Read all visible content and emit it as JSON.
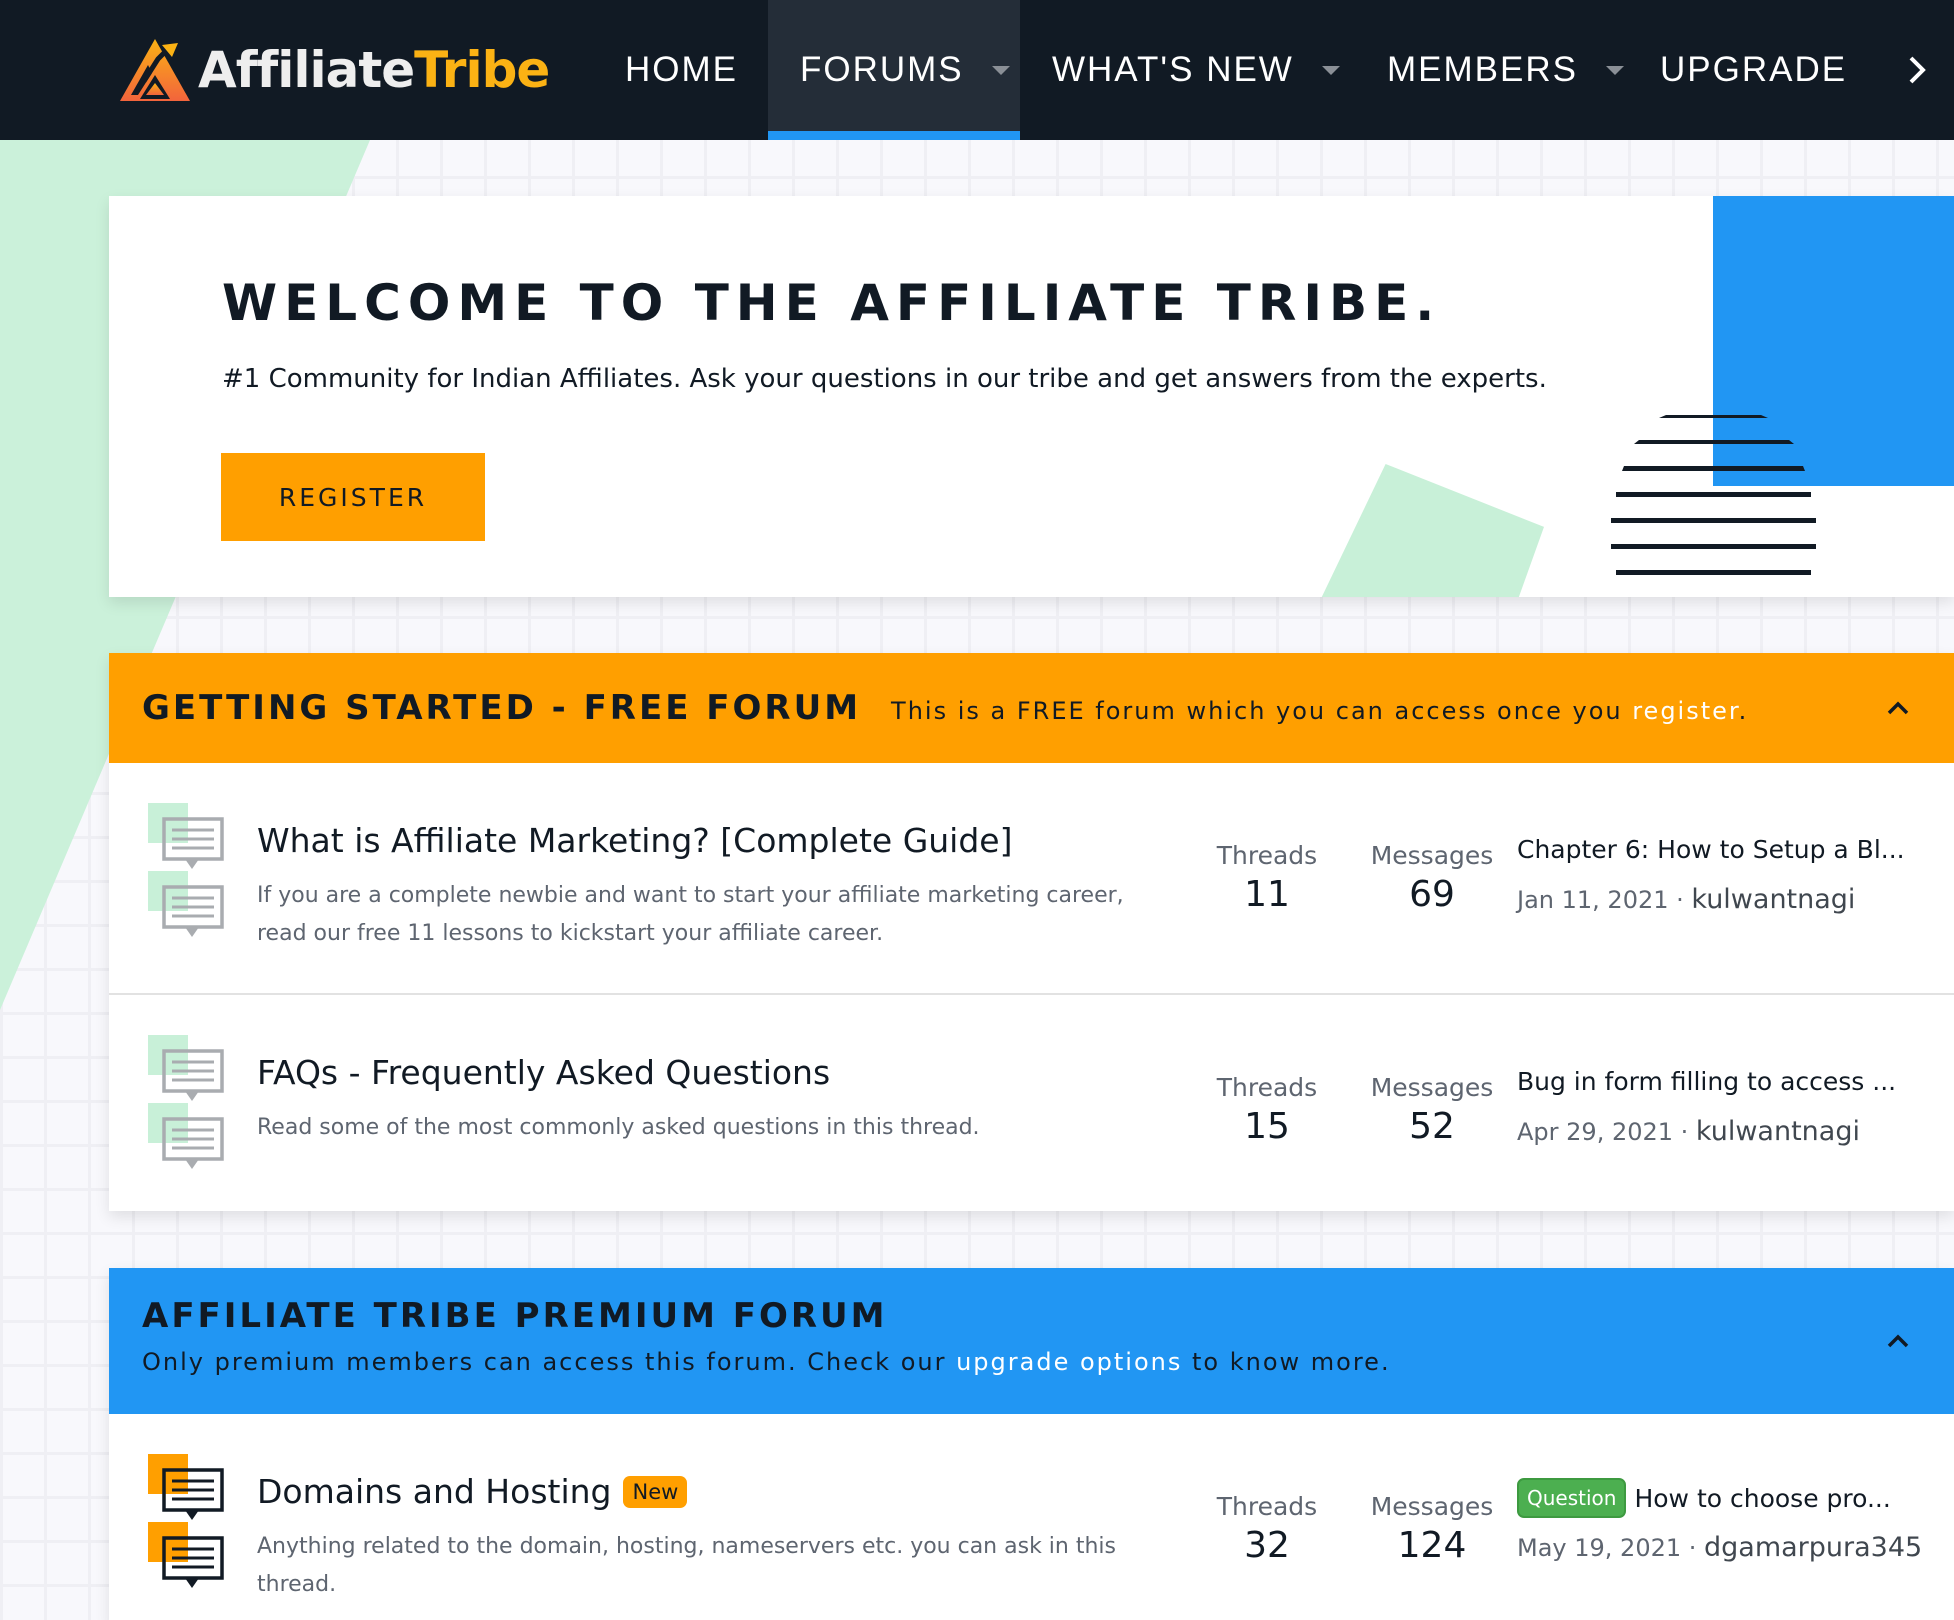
{
  "nav": {
    "logo": {
      "part1": "Affiliate",
      "part2": "Tribe"
    },
    "items": [
      {
        "label": "HOME",
        "has_dropdown": false,
        "active": false
      },
      {
        "label": "FORUMS",
        "has_dropdown": true,
        "active": true
      },
      {
        "label": "WHAT'S NEW",
        "has_dropdown": true,
        "active": false
      },
      {
        "label": "MEMBERS",
        "has_dropdown": true,
        "active": false
      },
      {
        "label": "UPGRADE",
        "has_dropdown": false,
        "active": false
      }
    ],
    "more_icon": "chevron-right-icon"
  },
  "welcome": {
    "title": "WELCOME TO THE AFFILIATE TRIBE.",
    "subtitle": "#1 Community for Indian Affiliates. Ask your questions in our tribe and get answers from the experts.",
    "register_label": "REGISTER"
  },
  "sections": [
    {
      "title": "GETTING STARTED - FREE FORUM",
      "desc_before": "This is a FREE forum which you can access once you ",
      "desc_link": "register",
      "desc_after": ".",
      "color": "#ff9f00",
      "forums": [
        {
          "title": "What is Affiliate Marketing? [Complete Guide]",
          "desc": "If you are a complete newbie and want to start your affiliate marketing career, read our free 11 lessons to kickstart your affiliate career.",
          "threads_label": "Threads",
          "threads": "11",
          "messages_label": "Messages",
          "messages": "69",
          "latest_title": "Chapter 6: How to Setup a Bl...",
          "latest_date": "Jan 11, 2021",
          "latest_user": "kulwantnagi"
        },
        {
          "title": "FAQs - Frequently Asked Questions",
          "desc": "Read some of the most commonly asked questions in this thread.",
          "threads_label": "Threads",
          "threads": "15",
          "messages_label": "Messages",
          "messages": "52",
          "latest_title": "Bug in form filling to access ...",
          "latest_date": "Apr 29, 2021",
          "latest_user": "kulwantnagi"
        }
      ]
    },
    {
      "title": "AFFILIATE TRIBE PREMIUM FORUM",
      "desc_before": "Only premium members can access this forum. Check our ",
      "desc_link": "upgrade options",
      "desc_after": " to know more.",
      "color": "#2196f3",
      "forums": [
        {
          "title": "Domains and Hosting",
          "badge": "New",
          "desc": "Anything related to the domain, hosting, nameservers etc. you can ask in this thread.",
          "threads_label": "Threads",
          "threads": "32",
          "messages_label": "Messages",
          "messages": "124",
          "latest_prefix": "Question",
          "latest_title": "How to choose pro...",
          "latest_date": "May 19, 2021",
          "latest_user": "dgamarpura345"
        }
      ]
    }
  ],
  "meta_separator": " · "
}
